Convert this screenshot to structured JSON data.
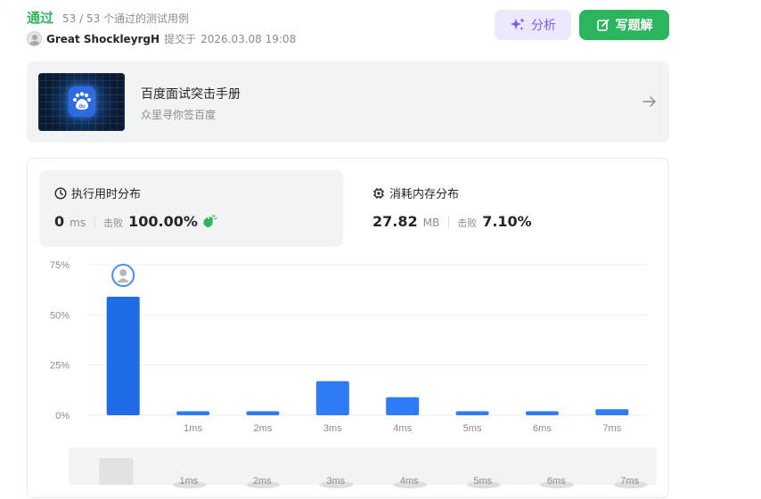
{
  "status": {
    "title": "通过",
    "count": "53 / 53 个通过的测试用例"
  },
  "author": {
    "name": "Great ShockleyrgH",
    "submit_label": "提交于",
    "submit_time": "2026.03.08 19:08"
  },
  "buttons": {
    "analyze": "分析",
    "solution": "写题解"
  },
  "promo": {
    "title": "百度面试突击手册",
    "subtitle": "众里寻你签百度"
  },
  "runtime": {
    "label": "执行用时分布",
    "value": "0",
    "unit": "ms",
    "beat_label": "击败",
    "beat_value": "100.00%"
  },
  "memory": {
    "label": "消耗内存分布",
    "value": "27.82",
    "unit": "MB",
    "beat_label": "击败",
    "beat_value": "7.10%"
  },
  "colors": {
    "accent_green": "#2db55d",
    "bar_blue": "#2f7bf6",
    "bar_selected": "#1f6ce6",
    "analyze_purple": "#7c5cf0"
  },
  "chart_data": {
    "type": "bar",
    "categories": [
      "",
      "1ms",
      "2ms",
      "3ms",
      "4ms",
      "5ms",
      "6ms",
      "7ms"
    ],
    "values": [
      59,
      2,
      2,
      17,
      9,
      2,
      2,
      3
    ],
    "y_ticks": [
      "0%",
      "25%",
      "50%",
      "75%"
    ],
    "ylim": [
      0,
      75
    ],
    "selected_index": 0,
    "brush_labels": [
      "1ms",
      "2ms",
      "3ms",
      "4ms",
      "5ms",
      "6ms",
      "7ms"
    ],
    "grid": true
  }
}
